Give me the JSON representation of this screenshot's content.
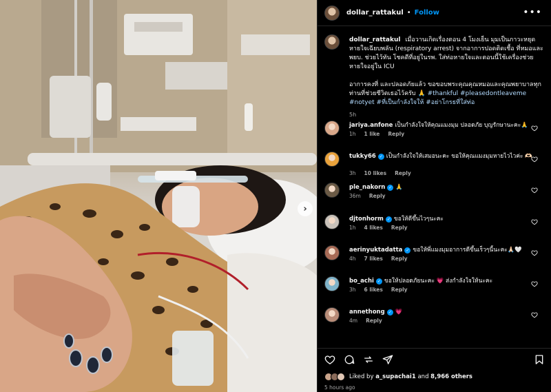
{
  "header": {
    "username": "dollar_rattakul",
    "separator": "•",
    "follow_label": "Follow",
    "more_icon": "more-horizontal-icon"
  },
  "caption": {
    "username": "dollar_rattakul",
    "paragraph1": "เมื่อวานเกิดเรื่องตอน 4 โมงเย็น มุมเป็นภาวะหยุดหายใจเฉียบพลัน (respiratory arrest) จากอาการปอดติดเชื้อ ที่หมอและพยบ. ช่วยไว้ทัน โชคดีที่อยู่ในรพ. ใส่ท่อหายใจและตอนนี้ใช้เครื่องช่วยหายใจอยู่ใน ICU",
    "paragraph2_text": "อาการคงที่ และปลอดภัยแล้ว ขอขอบพระคุณคุณหมอและคุณพยาบาลทุกท่านที่ช่วยชีวิตเธอไว้ครับ 🙏 ",
    "paragraph2_tags": "#thankful #pleasedontleaveme #notyet #ที่เป็นกำลังใจให้ #อย่าโกรธที่ใส่ท่อ",
    "time": "5h"
  },
  "comments": [
    {
      "username": "jariya.anfone",
      "verified": false,
      "text": "เป็นกำลังใจให้คุณแมงมุม ปลอดภัย บุญรักษานะคะ🙏",
      "time": "1h",
      "likes": "1 like",
      "reply": "Reply",
      "avatar_color": "#d9a88a"
    },
    {
      "username": "tukky66",
      "verified": true,
      "text": "เป็นกำลังใจให้เสมอนะคะ ขอให้คุณแมงมุมหายไวไวค่ะ 🫶🏻",
      "time": "3h",
      "likes": "10 likes",
      "reply": "Reply",
      "avatar_color": "#e9a23b"
    },
    {
      "username": "ple_nakorn",
      "verified": true,
      "text": "🙏",
      "time": "36m",
      "likes": "",
      "reply": "Reply",
      "avatar_color": "#6b5a45"
    },
    {
      "username": "djtonhorm",
      "verified": true,
      "text": "ขอให้ดีขึ้นไวๆนะคะ",
      "time": "1h",
      "likes": "4 likes",
      "reply": "Reply",
      "avatar_color": "#c9c2ba"
    },
    {
      "username": "aerinyuktadatta",
      "verified": true,
      "text": "ขอให้พี่แมงมุมอาการดีขึ้นเร็วๆนี้นะคะ🙏🏻🤍",
      "time": "4h",
      "likes": "7 likes",
      "reply": "Reply",
      "avatar_color": "#a86b56"
    },
    {
      "username": "bo_achi",
      "verified": true,
      "text": "ขอให้ปลอดภัยนะคะ 💗 ส่งกำลังใจให้นะคะ",
      "time": "3h",
      "likes": "6 likes",
      "reply": "Reply",
      "avatar_color": "#7fb3c9"
    },
    {
      "username": "annethong",
      "verified": true,
      "text": "💗",
      "time": "4m",
      "likes": "",
      "reply": "Reply",
      "avatar_color": "#b88c78"
    }
  ],
  "footer": {
    "liked_by_prefix": "Liked by",
    "liked_by_user": "a_supachai1",
    "liked_by_and": "and",
    "liked_by_count": "8,966 others",
    "post_time": "5 hours ago",
    "icons": [
      "heart-icon",
      "comment-icon",
      "share-icon",
      "send-icon",
      "bookmark-icon"
    ]
  },
  "colors": {
    "accent": "#0095f6",
    "background": "#000000",
    "muted": "#a8a8a8",
    "hashtag": "#b3dbff"
  }
}
